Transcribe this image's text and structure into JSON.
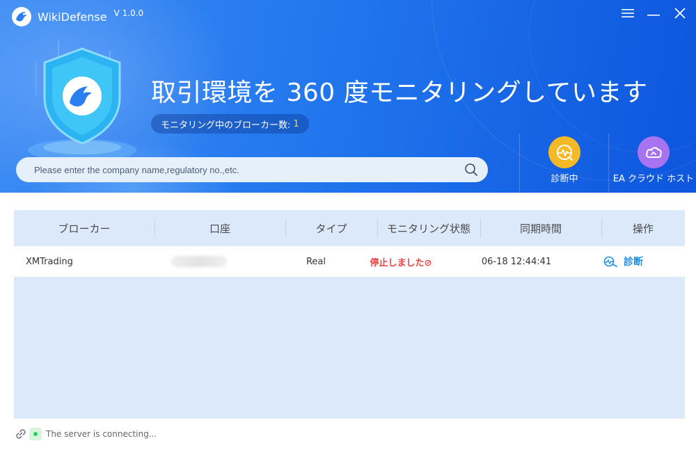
{
  "app": {
    "name": "WikiDefense",
    "version": "V 1.0.0"
  },
  "window_controls": [
    "menu-icon",
    "minimize-icon",
    "close-icon"
  ],
  "hero": {
    "headline": "取引環境を 360 度モニタリングしています",
    "broker_count_label": "モニタリング中のブローカー数:",
    "broker_count_value": "1"
  },
  "search": {
    "placeholder": "Please enter the company name,regulatory no.,etc.",
    "value": ""
  },
  "actions": {
    "diagnose": {
      "label": "診断中",
      "icon": "diagnose-pulse-icon",
      "color": "#f6b926"
    },
    "ea_cloud": {
      "label": "EA クラウド ホスト",
      "icon": "cloud-icon",
      "color": "#a873f0"
    }
  },
  "table": {
    "columns": [
      "ブローカー",
      "口座",
      "タイプ",
      "モニタリング状態",
      "同期時間",
      "操作"
    ],
    "rows": [
      {
        "broker": "XMTrading",
        "account": "",
        "type": "Real",
        "status": "停止しました⊘",
        "sync_time": "06-18 12:44:41",
        "action": "診断"
      }
    ]
  },
  "footer": {
    "status_text": "The server is connecting..."
  },
  "colors": {
    "header_gradient_start": "#3d8cf5",
    "header_gradient_end": "#0d56dd",
    "panel_bg": "#dbe9fb",
    "status_stopped": "#ee3f3f",
    "link": "#1a8fe6",
    "count_highlight": "#ffd24d"
  }
}
